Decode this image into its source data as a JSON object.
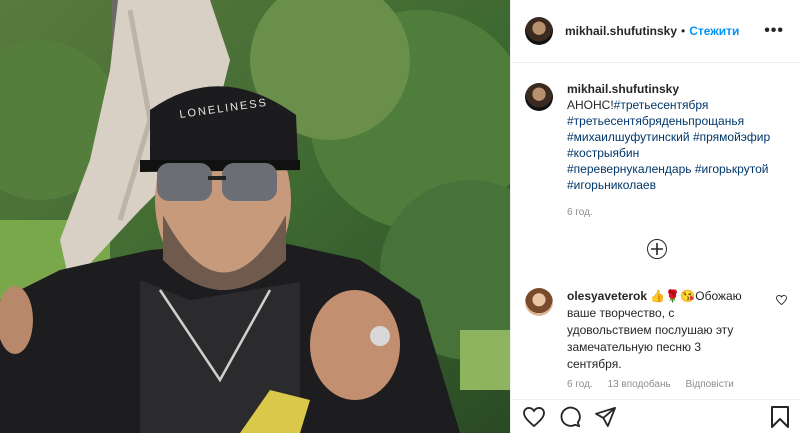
{
  "post": {
    "username": "mikhail.shufutinsky",
    "follow_label": "Стежити",
    "dot": "•",
    "more": "•••",
    "caption_lead": "АНОНС!",
    "hashtags": [
      "#третьесентября",
      "#третьесентябряденьпрощанья",
      "#михаилшуфутинский",
      "#прямойэфир",
      "#кострыябин",
      "#перевернукалендарь",
      "#игорькрутой",
      "#игорьниколаев"
    ],
    "time_ago": "6 год."
  },
  "comment": {
    "username": "olesyaveterok",
    "emojis": "👍🌹😘",
    "text": "Обожаю ваше творчество, с удовольствием послушаю эту замечательную песню 3 сентября.",
    "time": "6 год.",
    "likes": "13 вподобань",
    "reply": "Відповісти"
  },
  "icons": [
    "heart-icon",
    "comment-icon",
    "share-icon",
    "bookmark-icon",
    "plus-circle-icon"
  ]
}
